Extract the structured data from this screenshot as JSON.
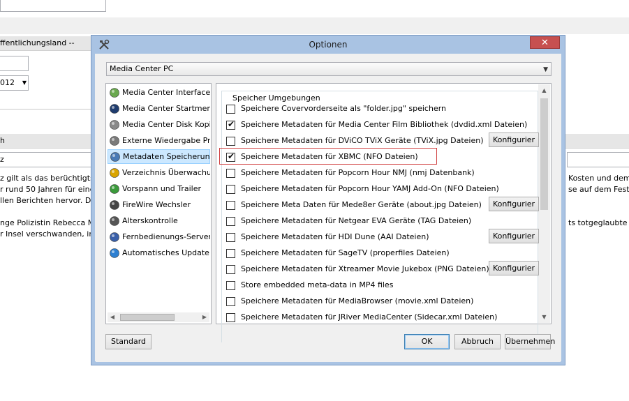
{
  "background": {
    "header_text": "ffentlichungsland --",
    "year_value": "012",
    "row_header": "h",
    "row_value": "z",
    "text_lines": [
      "z gilt als das berüchtigtst",
      "r rund 50 Jahren für eine",
      "llen Berichten hervor. Doc",
      "",
      "nge Polizistin Rebecca Ma",
      "r Insel verschwanden, in"
    ],
    "right_lines": [
      "Kosten und dem",
      "se auf dem Festlar",
      "",
      "",
      "ts totgeglaubte Inse"
    ]
  },
  "dialog": {
    "title": "Optionen",
    "close_glyph": "✕",
    "profile_select": "Media Center PC",
    "nav_items": [
      {
        "label": "Media Center Interface",
        "icon": "media-center-logo-icon",
        "color": "#6aa84f"
      },
      {
        "label": "Media Center Startmenü",
        "icon": "start-menu-icon",
        "color": "#1f3c6e"
      },
      {
        "label": "Media Center Disk Kopie",
        "icon": "disk-copy-icon",
        "color": "#8a8a8a"
      },
      {
        "label": "Externe Wiedergabe Prog",
        "icon": "external-player-icon",
        "color": "#7a7a7a"
      },
      {
        "label": "Metadaten Speicherung",
        "icon": "metadata-storage-icon",
        "color": "#4a7ab5"
      },
      {
        "label": "Verzeichnis Überwachung",
        "icon": "folder-watch-icon",
        "color": "#d9a400"
      },
      {
        "label": "Vorspann und Trailer",
        "icon": "trailer-play-icon",
        "color": "#3b9a3b"
      },
      {
        "label": "FireWire Wechsler",
        "icon": "firewire-icon",
        "color": "#444444"
      },
      {
        "label": "Alterskontrolle",
        "icon": "parental-control-icon",
        "color": "#555555"
      },
      {
        "label": "Fernbedienungs-Server",
        "icon": "remote-control-icon",
        "color": "#3a5fa8"
      },
      {
        "label": "Automatisches Update",
        "icon": "update-icon",
        "color": "#2d7fd1"
      }
    ],
    "selected_nav_index": 4,
    "group_title": "Speicher Umgebungen",
    "options": [
      {
        "label": "Speichere Covervorderseite als \"folder.jpg\" speichern",
        "checked": false,
        "configure": ""
      },
      {
        "label": "Speichere Metadaten für Media Center Film Bibliothek (dvdid.xml Dateien)",
        "checked": true,
        "configure": ""
      },
      {
        "label": "Speichere Metadaten für DViCO TViX Geräte (TViX.jpg Dateien)",
        "checked": false,
        "configure": "Konfigurier"
      },
      {
        "label": "Speichere Metadaten für XBMC (NFO Dateien)",
        "checked": true,
        "configure": ""
      },
      {
        "label": "Speichere Metadaten für Popcorn Hour NMJ (nmj Datenbank)",
        "checked": false,
        "configure": ""
      },
      {
        "label": "Speichere Metadaten für Popcorn Hour YAMJ Add-On (NFO Dateien)",
        "checked": false,
        "configure": ""
      },
      {
        "label": "Speichere Meta Daten für Mede8er Geräte (about.jpg Dateien)",
        "checked": false,
        "configure": "Konfigurier"
      },
      {
        "label": "Speichere Metadaten für Netgear EVA Geräte (TAG Dateien)",
        "checked": false,
        "configure": ""
      },
      {
        "label": "Speichere Metadaten für HDI Dune (AAI Dateien)",
        "checked": false,
        "configure": "Konfigurier"
      },
      {
        "label": "Speichere Metadaten für SageTV (properfiles Dateien)",
        "checked": false,
        "configure": ""
      },
      {
        "label": "Speichere Metadaten für Xtreamer Movie Jukebox (PNG Dateien)",
        "checked": false,
        "configure": "Konfigurier"
      },
      {
        "label": "Store embedded meta-data in MP4 files",
        "checked": false,
        "configure": ""
      },
      {
        "label": "Speichere Metadaten für MediaBrowser (movie.xml Dateien)",
        "checked": false,
        "configure": ""
      },
      {
        "label": "Speichere Metadaten für JRiver MediaCenter (Sidecar.xml Dateien)",
        "checked": false,
        "configure": ""
      }
    ],
    "buttons": {
      "standard": "Standard",
      "ok": "OK",
      "cancel": "Abbruch",
      "apply": "Übernehmen"
    }
  }
}
